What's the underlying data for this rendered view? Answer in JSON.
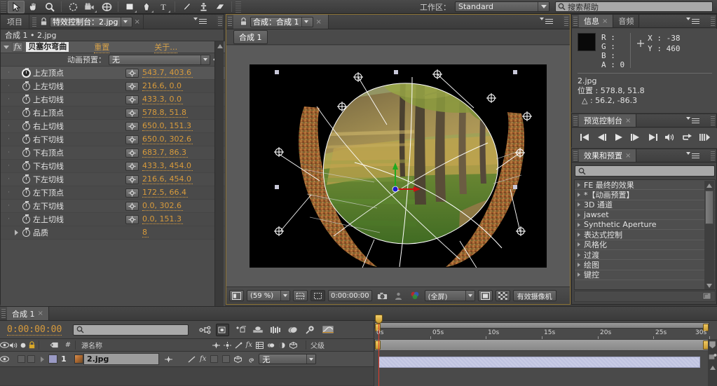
{
  "toolbar": {
    "tools": [
      {
        "name": "selection-tool",
        "selected": true
      },
      {
        "name": "hand-tool",
        "selected": false
      },
      {
        "name": "zoom-tool",
        "selected": false
      },
      {
        "name": "rotation-tool",
        "selected": false
      },
      {
        "name": "camera-tool",
        "selected": false
      },
      {
        "name": "pan-behind-tool",
        "selected": false
      },
      {
        "name": "shape-tool",
        "selected": false
      },
      {
        "name": "pen-tool",
        "selected": false
      },
      {
        "name": "text-tool",
        "selected": false
      },
      {
        "name": "brush-tool",
        "selected": false
      },
      {
        "name": "clone-stamp-tool",
        "selected": false
      },
      {
        "name": "eraser-tool",
        "selected": false
      }
    ],
    "workspace_label": "工作区：",
    "workspace_value": "Standard",
    "help_placeholder": "搜索帮助"
  },
  "effect_controls": {
    "tab_project": "项目",
    "tab_title": "特效控制台：2.jpg",
    "close_glyph": "×",
    "comp_path": "合成 1 • 2.jpg",
    "effect_name": "贝塞尔弯曲",
    "fx_badge": "fx",
    "reset_label": "重置",
    "about_label": "关于…",
    "preset_label": "动画预置：",
    "preset_value": "无",
    "params": [
      {
        "name": "上左顶点",
        "value": "543.7, 403.6",
        "keyed": true
      },
      {
        "name": "上左切线",
        "value": "216.6, 0.0",
        "keyed": false
      },
      {
        "name": "上右切线",
        "value": "433.3, 0.0",
        "keyed": false
      },
      {
        "name": "右上顶点",
        "value": "578.8, 51.8",
        "keyed": false
      },
      {
        "name": "右上切线",
        "value": "650.0, 151.3",
        "keyed": false
      },
      {
        "name": "右下切线",
        "value": "650.0, 302.6",
        "keyed": false
      },
      {
        "name": "下右顶点",
        "value": "683.7, 86.3",
        "keyed": false
      },
      {
        "name": "下右切线",
        "value": "433.3, 454.0",
        "keyed": false
      },
      {
        "name": "下左切线",
        "value": "216.6, 454.0",
        "keyed": false
      },
      {
        "name": "左下顶点",
        "value": "172.5, 66.4",
        "keyed": false
      },
      {
        "name": "左下切线",
        "value": "0.0, 302.6",
        "keyed": false
      },
      {
        "name": "左上切线",
        "value": "0.0, 151.3",
        "keyed": false
      }
    ],
    "quality": {
      "name": "品质",
      "value": "8"
    }
  },
  "composition": {
    "tab_title": "合成：合成 1",
    "close_glyph": "×",
    "subtab": "合成 1",
    "footer": {
      "zoom": "(59 %)",
      "time": "0:00:00:00",
      "resolution": "(全屏)",
      "camera": "有效摄像机"
    }
  },
  "info": {
    "tab_info": "信息",
    "tab_audio": "音频",
    "close_glyph": "×",
    "r_label": "R :",
    "g_label": "G :",
    "b_label": "B :",
    "a_label": "A : 0",
    "x_label": "X : -38",
    "y_label": "Y : 460",
    "layer_name": "2.jpg",
    "position_label": "位置 : 578.8, 51.8",
    "delta_label": "△ : 56.2, -86.3",
    "swatch_color": "#090909"
  },
  "preview": {
    "tab_title": "预览控制台",
    "close_glyph": "×",
    "buttons": [
      "first-frame-icon",
      "previous-frame-icon",
      "play-icon",
      "next-frame-icon",
      "last-frame-icon",
      "audio-icon",
      "loop-icon",
      "ram-preview-icon"
    ]
  },
  "effects_presets": {
    "tab_title": "效果和预置",
    "close_glyph": "×",
    "search_placeholder": "",
    "items": [
      "FE 最终的效果",
      "*【动画预置】",
      "3D 通道",
      "jawset",
      "Synthetic Aperture",
      "表达式控制",
      "风格化",
      "过渡",
      "绘图",
      "键控"
    ]
  },
  "timeline": {
    "tab_title": "合成 1",
    "close_glyph": "×",
    "current_time": "0:00:00:00",
    "search_placeholder": "",
    "columns": {
      "source_name": "源名称",
      "number": "#",
      "parent": "父级"
    },
    "layer": {
      "index": "1",
      "source_name": "2.jpg",
      "parent_value": "无"
    },
    "ruler": {
      "ticks": [
        "0s",
        "05s",
        "10s",
        "15s",
        "20s",
        "25s",
        "30s"
      ],
      "start": 0,
      "end": 30
    }
  },
  "colors": {
    "accent_orange": "#d89b3c",
    "panel_bg": "#4a4a4a",
    "highlight_border": "#8d7437"
  }
}
